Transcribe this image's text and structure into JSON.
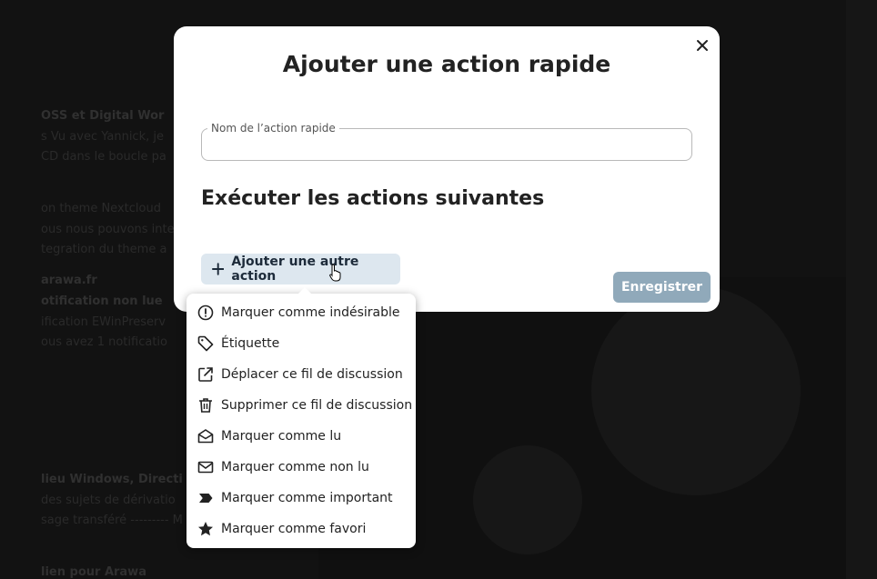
{
  "modal": {
    "title": "Ajouter une action rapide",
    "close_glyph": "✕",
    "name_field": {
      "label": "Nom de l’action rapide",
      "value": "",
      "placeholder": ""
    },
    "section_title": "Exécuter les actions suivantes",
    "add_action_label": "Ajouter une autre action",
    "save_label": "Enregistrer"
  },
  "menu": {
    "items": [
      {
        "label": "Marquer comme indésirable",
        "icon": "alert-circle-icon"
      },
      {
        "label": "Étiquette",
        "icon": "tag-icon"
      },
      {
        "label": "Déplacer ce fil de discussion",
        "icon": "external-link-icon"
      },
      {
        "label": "Supprimer ce fil de discussion",
        "icon": "trash-icon"
      },
      {
        "label": "Marquer comme lu",
        "icon": "mail-open-icon"
      },
      {
        "label": "Marquer comme non lu",
        "icon": "mail-icon"
      },
      {
        "label": "Marquer comme important",
        "icon": "important-icon"
      },
      {
        "label": "Marquer comme favori",
        "icon": "star-icon"
      }
    ]
  },
  "background": {
    "lines": [
      "OSS et Digital Wor",
      "s Vu avec Yannick, je",
      "CD dans le boucle pa",
      "on theme Nextcloud",
      "ous nous pouvons inte",
      "tegration du theme a",
      "arawa.fr",
      "otification non lue",
      "ification EWinPreserv",
      "ous avez 1 notificatio",
      "lieu Windows, Directi",
      "des sujets de dérivatio",
      "sage transféré --------- M",
      "lien pour Arawa"
    ]
  },
  "colors": {
    "modal_bg": "#ffffff",
    "save_button": "#90a9ba",
    "add_button": "#dde7ef",
    "overlay": "#121212"
  }
}
